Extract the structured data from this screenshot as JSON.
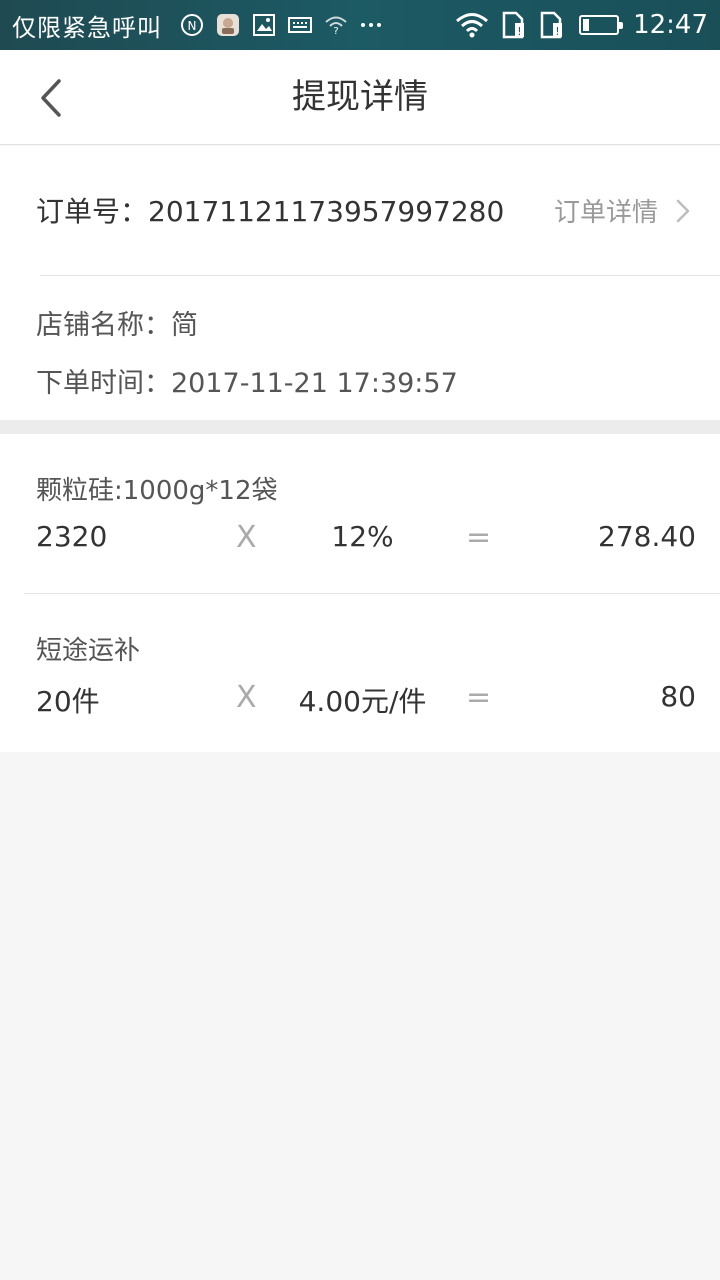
{
  "status_bar": {
    "carrier_text": "仅限紧急呼叫",
    "time": "12:47",
    "icons_left": [
      "nfc-icon",
      "avatar-notification-icon",
      "image-icon",
      "keyboard-icon",
      "wifi-question-icon",
      "more-icon"
    ],
    "icons_right": [
      "wifi-icon",
      "sim1-icon",
      "sim2-icon",
      "battery-icon"
    ],
    "background": "#1c5a64"
  },
  "nav": {
    "title": "提现详情"
  },
  "order": {
    "number_label": "订单号：",
    "number_value": "20171121173957997280",
    "detail_link": "订单详情",
    "shop_label": "店铺名称：",
    "shop_value": "简",
    "time_label": "下单时间：",
    "time_value": "2017-11-21 17:39:57"
  },
  "items": [
    {
      "name": "颗粒硅:1000g*12袋",
      "qty": "2320",
      "operator": "X",
      "rate": "12%",
      "equals": "=",
      "total": "278.40"
    },
    {
      "name": "短途运补",
      "qty": "20件",
      "operator": "X",
      "rate": "4.00元/件",
      "equals": "=",
      "total": "80"
    }
  ],
  "colors": {
    "page_background": "#f6f6f6",
    "card_background": "#ffffff",
    "divider": "#e5e5e5",
    "muted_text": "#9a9a9a"
  }
}
